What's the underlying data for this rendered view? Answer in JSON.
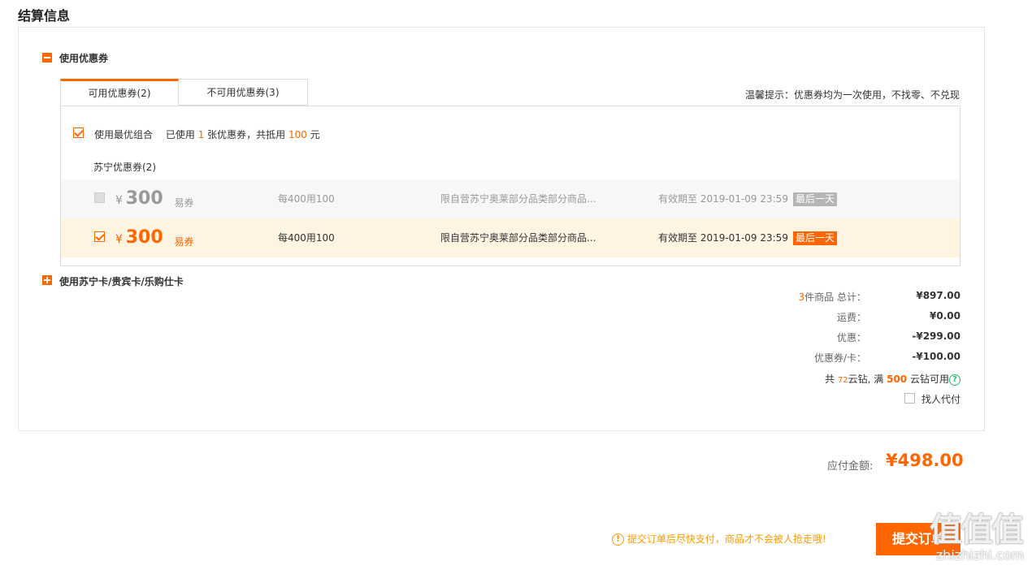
{
  "page_title": "结算信息",
  "coupon_section": {
    "label": "使用优惠券",
    "tabs": [
      {
        "label": "可用优惠券(2)"
      },
      {
        "label": "不可用优惠券(3)"
      }
    ],
    "tip": "温馨提示：优惠券均为一次使用，不找零、不兑现",
    "best_combo": {
      "label": "使用最优组合",
      "used_prefix": "已使用",
      "used_count": "1",
      "used_mid": "张优惠券，共抵用",
      "amount": "100",
      "unit": "元"
    },
    "group_label": "苏宁优惠券(2)",
    "coupons": [
      {
        "yen": "¥",
        "value": "300",
        "type": "易券",
        "rule": "每400用100",
        "scope": "限自营苏宁奥莱部分品类部分商品...",
        "expiry": "有效期至 2019-01-09 23:59",
        "badge": "最后一天"
      },
      {
        "yen": "¥",
        "value": "300",
        "type": "易券",
        "rule": "每400用100",
        "scope": "限自营苏宁奥莱部分品类部分商品...",
        "expiry": "有效期至 2019-01-09 23:59",
        "badge": "最后一天"
      }
    ]
  },
  "card_section": {
    "label": "使用苏宁卡/贵宾卡/乐购仕卡"
  },
  "summary": {
    "count": "3",
    "total_label": "件商品  总计：",
    "total": "¥897.00",
    "shipping_label": "运费：",
    "shipping": "¥0.00",
    "discount_label": "优惠：",
    "discount": "-¥299.00",
    "coupon_label": "优惠券/卡：",
    "coupon": "-¥100.00",
    "diamond_prefix": "共",
    "diamond_count": "72",
    "diamond_mid": "云钻, 满",
    "diamond_threshold": "500",
    "diamond_suffix": "云钻可用",
    "help_glyph": "?",
    "proxy_pay": "找人代付"
  },
  "payable": {
    "label": "应付金额:",
    "amount": "¥498.00"
  },
  "footer": {
    "notice_glyph": "!",
    "notice": "提交订单后尽快支付，商品才不会被人抢走哦!",
    "submit": "提交订单"
  },
  "watermark": {
    "logo": "值值值",
    "site": "zhizhizhi.com"
  },
  "colors": {
    "accent": "#ff6600",
    "badge_gray": "#b5b5b5",
    "highlight_row": "#fff3e2",
    "gray_row": "#f7f7f7"
  }
}
